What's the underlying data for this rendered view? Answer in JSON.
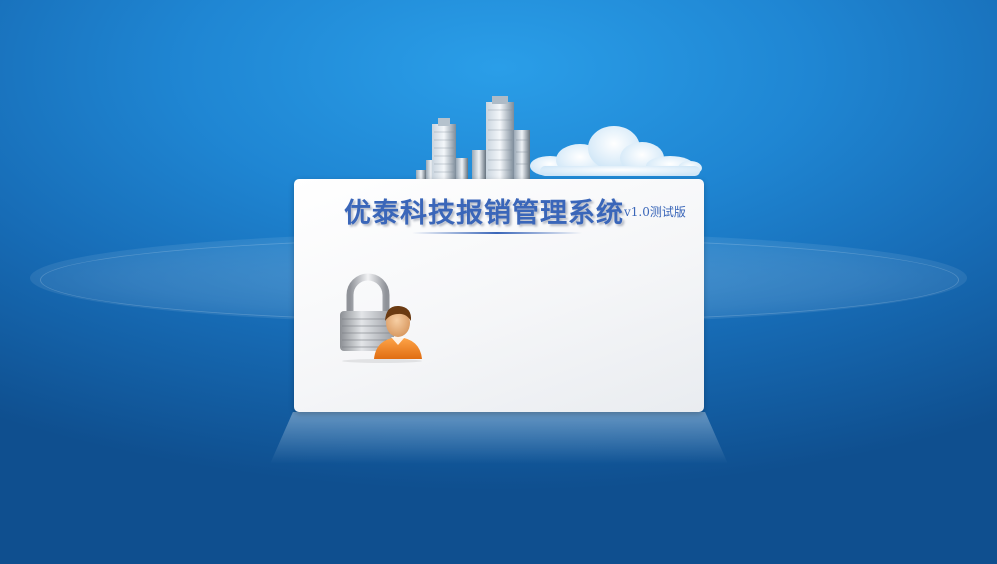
{
  "login": {
    "title": "优泰科技报销管理系统",
    "version": "v1.0测试版"
  },
  "icons": {
    "header": [
      "buildings-icon",
      "cloud-icon"
    ],
    "card": "lock-user-icon"
  },
  "colors": {
    "background_top": "#2a9ee8",
    "background_bottom": "#0f4f8f",
    "title": "#3a66b9",
    "card": "#f5f6f8"
  }
}
